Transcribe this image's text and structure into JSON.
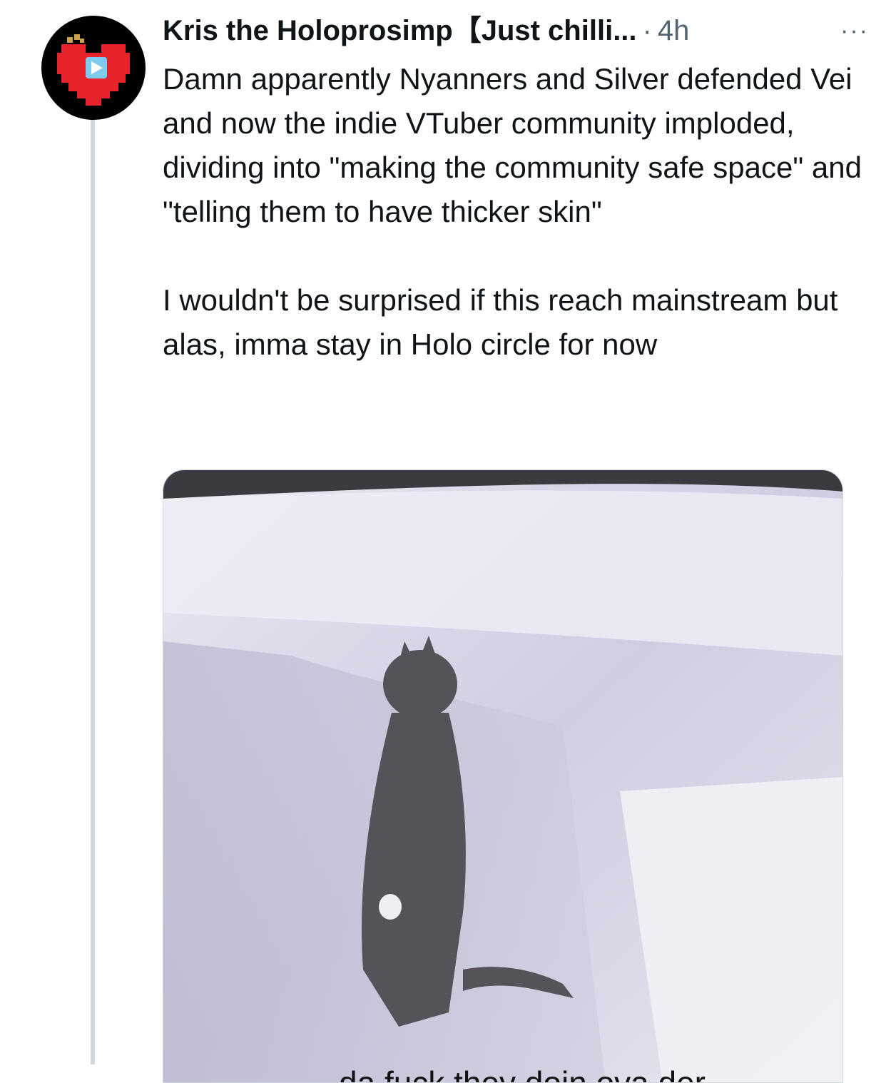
{
  "tweet": {
    "author_name": "Kris the Holoprosimp【Just chilli...",
    "separator": "·",
    "time": "4h",
    "more_label": "···",
    "paragraphs": [
      "Damn apparently Nyanners and Silver defended Vei and now the indie VTuber community imploded, dividing into \"making the community safe space\" and \"telling them to have thicker skin\"",
      "I wouldn't be surprised if this reach mainstream but alas, imma stay in Holo circle for now"
    ]
  },
  "media": {
    "caption": "da fuck they doin ova der"
  },
  "colors": {
    "text": "#0f1419",
    "muted": "#536471",
    "thread_line": "#cfd9de",
    "avatar_bg": "#000000",
    "heart_red": "#e8232b"
  },
  "icons": {
    "avatar": "pixel-heart-play-icon",
    "more": "more-horizontal-icon"
  }
}
